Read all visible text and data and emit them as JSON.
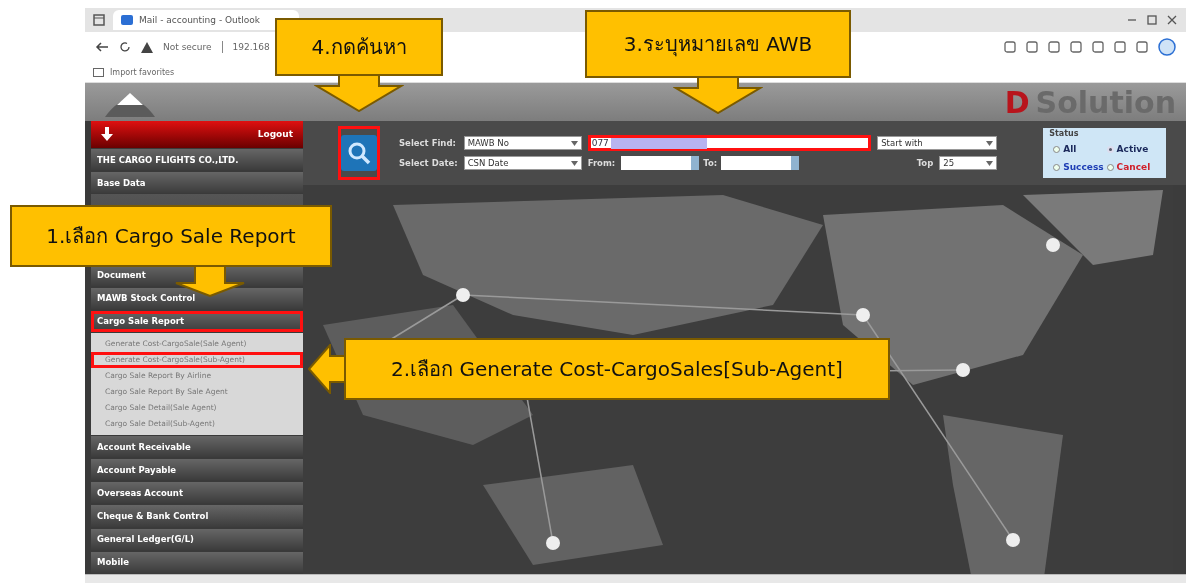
{
  "browser": {
    "tab_title": "Mail - accounting - Outlook",
    "security": "Not secure",
    "address": "192.168",
    "bookmarks": [
      "Import favorites"
    ]
  },
  "header": {
    "logo_mark": "D",
    "logo_text": "Solution"
  },
  "sidebar": {
    "logout": "Logout",
    "company": "THE CARGO FLIGHTS CO.,LTD.",
    "items": [
      {
        "label": "Base Data",
        "highlighted": false
      },
      {
        "label": "Document",
        "highlighted": false
      },
      {
        "label": "MAWB Stock Control",
        "highlighted": false
      },
      {
        "label": "Cargo Sale Report",
        "highlighted": true,
        "expanded": true,
        "children": [
          {
            "label": "Generate Cost-CargoSale(Sale Agent)",
            "highlighted": false
          },
          {
            "label": "Generate Cost-CargoSale(Sub-Agent)",
            "highlighted": true
          },
          {
            "label": "Cargo Sale Report By Airline",
            "highlighted": false
          },
          {
            "label": "Cargo Sale Report By Sale Agent",
            "highlighted": false
          },
          {
            "label": "Cargo Sale Detail(Sale Agent)",
            "highlighted": false
          },
          {
            "label": "Cargo Sale Detail(Sub-Agent)",
            "highlighted": false
          }
        ]
      },
      {
        "label": "Account Receivable",
        "highlighted": false
      },
      {
        "label": "Account Payable",
        "highlighted": false
      },
      {
        "label": "Overseas Account",
        "highlighted": false
      },
      {
        "label": "Cheque & Bank Control",
        "highlighted": false
      },
      {
        "label": "General Ledger(G/L)",
        "highlighted": false
      },
      {
        "label": "Mobile",
        "highlighted": false
      }
    ]
  },
  "search": {
    "search_highlighted": true,
    "find_label": "Select Find:",
    "find_by": "MAWB No",
    "find_value": "077",
    "find_redacted": true,
    "find_highlighted": true,
    "match": "Start with",
    "date_label": "Select Date:",
    "date_by": "CSN Date",
    "from_label": "From:",
    "to_label": "To:",
    "top_label": "Top",
    "top_value": "25"
  },
  "status": {
    "title": "Status",
    "options": [
      {
        "label": "All",
        "selected": false,
        "color": "#1c2a5c"
      },
      {
        "label": "Active",
        "selected": true,
        "color": "#1c2a5c"
      },
      {
        "label": "Success",
        "selected": false,
        "color": "#1f3fb5"
      },
      {
        "label": "Cancel",
        "selected": false,
        "color": "#d0202a"
      }
    ]
  },
  "annotations": [
    {
      "text": "4.กดค้นหา",
      "kind": "down"
    },
    {
      "text": "3.ระบุหมายเลข AWB",
      "kind": "down"
    },
    {
      "text": "1.เลือก Cargo Sale Report",
      "kind": "down"
    },
    {
      "text": "2.เลือก Generate Cost-CargoSales[Sub-Agent]",
      "kind": "left"
    }
  ]
}
